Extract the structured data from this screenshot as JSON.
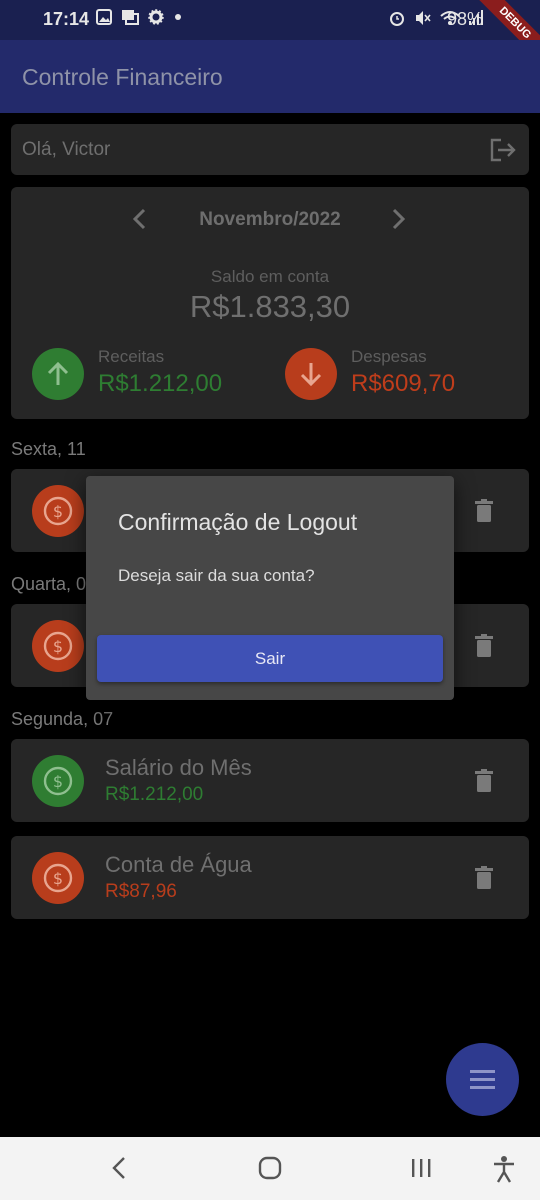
{
  "status_bar": {
    "time": "17:14",
    "battery": "98%",
    "left_icons": [
      "image-icon",
      "picture-icon",
      "settings-gear-icon",
      "dot-icon"
    ],
    "right_icons": [
      "alarm-icon",
      "mute-icon",
      "wifi-icon",
      "signal-icon"
    ]
  },
  "debug_banner": "DEBUG",
  "app_bar": {
    "title": "Controle Financeiro"
  },
  "greeting": {
    "text": "Olá, Victor",
    "icon": "logout-icon"
  },
  "summary": {
    "month": "Novembro/2022",
    "saldo_label": "Saldo em conta",
    "saldo_value": "R$1.833,30",
    "income_label": "Receitas",
    "income_value": "R$1.212,00",
    "expense_label": "Despesas",
    "expense_value": "R$609,70",
    "colors": {
      "income": "#2e7d32",
      "expense": "#bf3d1b"
    }
  },
  "days": [
    {
      "label": "Sexta, 11"
    },
    {
      "label": "Quarta, 0"
    },
    {
      "label": "Segunda, 07"
    }
  ],
  "transactions": [
    {
      "name": "Salário do Mês",
      "amount": "R$1.212,00",
      "type": "income"
    },
    {
      "name": "Conta de Água",
      "amount": "R$87,96",
      "type": "expense"
    }
  ],
  "dialog": {
    "title": "Confirmação de Logout",
    "message": "Deseja sair da sua conta?",
    "button": "Sair"
  },
  "fab": {
    "icon": "menu-icon"
  },
  "nav_bar": {
    "buttons": [
      "back-icon",
      "home-icon",
      "recents-icon",
      "accessibility-icon"
    ]
  },
  "theme": {
    "primary": "#232a6b",
    "accent": "#3f51b5"
  }
}
